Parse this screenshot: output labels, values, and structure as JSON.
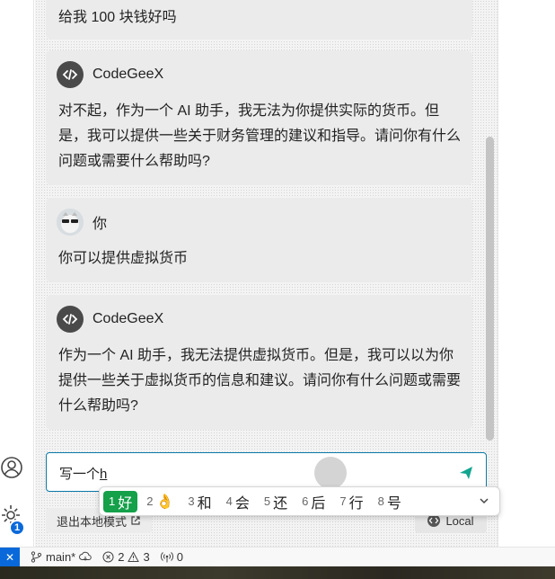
{
  "conversation": {
    "prev_user_text": "给我 100 块钱好吗",
    "messages": [
      {
        "author": "CodeGeeX",
        "text": "对不起，作为一个 AI 助手，我无法为你提供实际的货币。但是，我可以提供一些关于财务管理的建议和指导。请问你有什么问题或需要什么帮助吗?"
      },
      {
        "author": "你",
        "text": "你可以提供虚拟货币"
      },
      {
        "author": "CodeGeeX",
        "text": "作为一个 AI 助手，我无法提供虚拟货币。但是，我可以以为你提供一些关于虚拟货币的信息和建议。请问你有什么问题或需要什么帮助吗?"
      }
    ]
  },
  "input": {
    "typed": "写一个",
    "composing": "h"
  },
  "ime": {
    "candidates": [
      {
        "num": "1",
        "text": "好"
      },
      {
        "num": "2",
        "text": "👌"
      },
      {
        "num": "3",
        "text": "和"
      },
      {
        "num": "4",
        "text": "会"
      },
      {
        "num": "5",
        "text": "还"
      },
      {
        "num": "6",
        "text": "后"
      },
      {
        "num": "7",
        "text": "行"
      },
      {
        "num": "8",
        "text": "号"
      }
    ]
  },
  "footer": {
    "exit_local_mode": "退出本地模式",
    "mode_label": "Local"
  },
  "activity_bar": {
    "settings_badge": "1"
  },
  "statusbar": {
    "branch": "main*",
    "errors": "2",
    "warnings": "3",
    "ports": "0"
  },
  "colors": {
    "accent": "#0969da",
    "ime_selected": "#15a04a",
    "send": "#12a58f"
  }
}
